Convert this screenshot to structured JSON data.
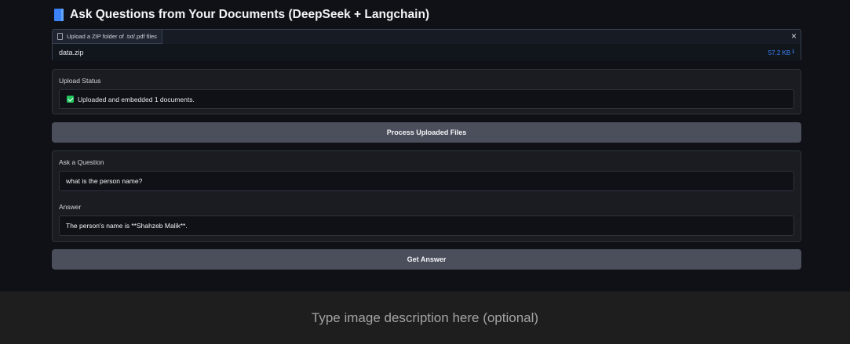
{
  "header": {
    "title": "Ask Questions from Your Documents (DeepSeek + Langchain)",
    "icon": "book-icon"
  },
  "file_upload": {
    "tab_label": "Upload a ZIP folder of .txt/.pdf files",
    "file_name": "data.zip",
    "file_size": "57.2 KB",
    "download_glyph": "⭳",
    "close_glyph": "×"
  },
  "status": {
    "label": "Upload Status",
    "text": "Uploaded and embedded 1 documents."
  },
  "process_button": {
    "label": "Process Uploaded Files"
  },
  "question": {
    "label": "Ask a Question",
    "value": "what is the person name?"
  },
  "answer": {
    "label": "Answer",
    "value": "The person's name is **Shahzeb Malik**."
  },
  "answer_button": {
    "label": "Get Answer"
  },
  "caption": {
    "text": "Type image description here (optional)"
  },
  "colors": {
    "accent": "#3b82f6",
    "success": "#22c55e",
    "button": "#4b4f5c"
  }
}
